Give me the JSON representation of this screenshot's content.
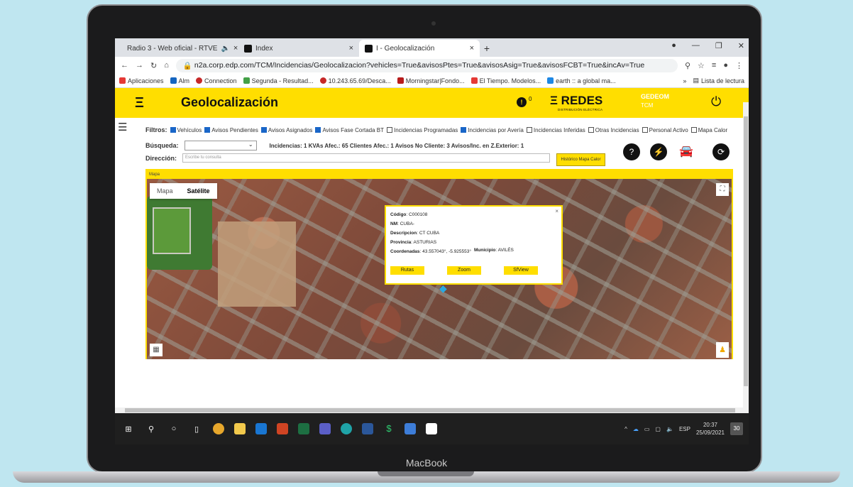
{
  "device": {
    "brand": "MacBook"
  },
  "browser": {
    "tabs": [
      {
        "label": "Radio 3 - Web oficial - RTVE",
        "color": "#e8591a",
        "active": false
      },
      {
        "label": "Index",
        "color": "#111111",
        "active": false
      },
      {
        "label": "I - Geolocalización",
        "color": "#111111",
        "active": true
      }
    ],
    "url_host": "n2a.corp.edp.com",
    "url_path": "/TCM/Incidencias/Geolocalizacion?vehicles=True&avisosPtes=True&avisosAsig=True&avisosFCBT=True&incAv=True",
    "bookmarks": [
      {
        "label": "Aplicaciones",
        "color": "#e53935"
      },
      {
        "label": "Alm",
        "color": "#1565c0"
      },
      {
        "label": "Connection",
        "color": "#c62828"
      },
      {
        "label": "Segunda - Resultad...",
        "color": "#43a047"
      },
      {
        "label": "10.243.65.69/Desca...",
        "color": "#c62828"
      },
      {
        "label": "Morningstar|Fondo...",
        "color": "#b71c1c"
      },
      {
        "label": "El Tiempo. Modelos...",
        "color": "#e53935"
      },
      {
        "label": "earth :: a global ma...",
        "color": "#1e88e5"
      }
    ],
    "reading_list": "Lista de lectura"
  },
  "app": {
    "title": "Geolocalización",
    "alert_count": "0",
    "brand": "REDES",
    "brand_sub": "DISTRIBUCIÓN ELÉCTRICA",
    "user_name": "GEDEOM",
    "user_role": "TCM",
    "accent_color": "#ffde00"
  },
  "filters": {
    "label": "Filtros:",
    "items": [
      {
        "label": "Vehículos",
        "checked": true
      },
      {
        "label": "Avisos Pendientes",
        "checked": true
      },
      {
        "label": "Avisos Asignados",
        "checked": true
      },
      {
        "label": "Avisos Fase Cortada BT",
        "checked": true
      },
      {
        "label": "Incidencias Programadas",
        "checked": false
      },
      {
        "label": "Incidencias por Avería",
        "checked": true
      },
      {
        "label": "Incidencias Inferidas",
        "checked": false
      },
      {
        "label": "Otras Incidencias",
        "checked": false
      },
      {
        "label": "Personal Activo",
        "checked": false
      },
      {
        "label": "Mapa Calor",
        "checked": false
      }
    ]
  },
  "search": {
    "label": "Búsqueda:",
    "stats": "Incidencias: 1   KVAs Afec.: 65   Clientes Afec.: 1   Avisos No Cliente: 3   Avisos/Inc. en Z.Exterior: 1"
  },
  "address": {
    "label": "Dirección:",
    "placeholder": "Escribe tu consulta",
    "button": "Histórico Mapa Calor"
  },
  "map": {
    "label": "Mapa",
    "type_map": "Mapa",
    "type_satellite": "Satélite",
    "popup": {
      "codigo_label": "Código",
      "codigo": "C000108",
      "nm_label": "NM",
      "nm": "CUBA-",
      "descripcion_label": "Descripcion",
      "descripcion": "CT CUBA",
      "provincia_label": "Provincia",
      "provincia": "ASTURIAS",
      "municipio_label": "Municipio",
      "municipio": "AVILÉS",
      "coordenadas_label": "Coordenadas",
      "coordenadas": "43.557043°, -5.925553°",
      "btn_rutas": "Rutas",
      "btn_zoom": "Zoom",
      "btn_sfview": "SfView"
    }
  },
  "taskbar": {
    "lang": "ESP",
    "time": "20:37",
    "date": "25/09/2021",
    "notifications": "30"
  }
}
